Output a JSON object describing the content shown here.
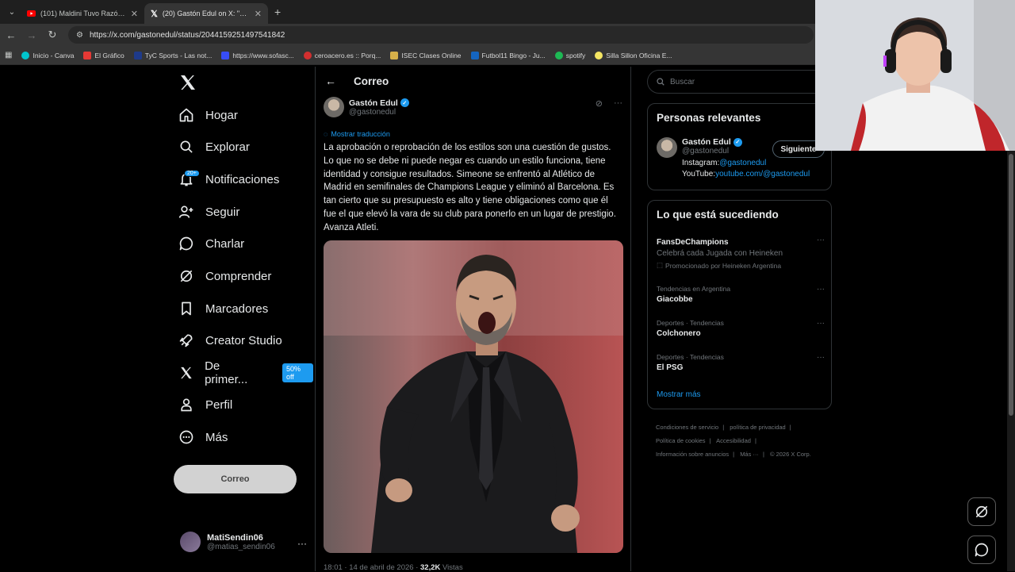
{
  "browser": {
    "tabs": [
      {
        "title": "(101) Maldini Tuvo Razón Sobr...",
        "icon": "youtube-icon",
        "color": "#ff0000",
        "active": false
      },
      {
        "title": "(20) Gastón Edul on X: \"La aprob...",
        "icon": "x-icon",
        "color": "#ffffff",
        "active": true
      }
    ],
    "url": "https://x.com/gastonedul/status/2044159251497541842",
    "bookmarks": [
      {
        "label": "Inicio - Canva",
        "color": "#00c4cc"
      },
      {
        "label": "El Gráfico",
        "color": "#e53935"
      },
      {
        "label": "TyC Sports - Las not...",
        "color": "#1e3a8a"
      },
      {
        "label": "https://www.sofasc...",
        "color": "#374df5"
      },
      {
        "label": "ceroacero.es :: Porq...",
        "color": "#d32f2f"
      },
      {
        "label": "ISEC Clases Online",
        "color": "#d6b04a"
      },
      {
        "label": "Futbol11 Bingo - Ju...",
        "color": "#1565c0"
      },
      {
        "label": "spotify",
        "color": "#1db954"
      },
      {
        "label": "Silla Sillon Oficina E...",
        "color": "#f5e663"
      }
    ]
  },
  "sidebar": {
    "items": [
      {
        "label": "Hogar",
        "icon": "home-icon"
      },
      {
        "label": "Explorar",
        "icon": "search-icon"
      },
      {
        "label": "Notificaciones",
        "icon": "bell-icon",
        "badge": "20+"
      },
      {
        "label": "Seguir",
        "icon": "follow-icon"
      },
      {
        "label": "Charlar",
        "icon": "chat-icon"
      },
      {
        "label": "Comprender",
        "icon": "grok-icon"
      },
      {
        "label": "Marcadores",
        "icon": "bookmark-icon"
      },
      {
        "label": "Creator Studio",
        "icon": "rocket-icon"
      },
      {
        "label": "De primer...",
        "icon": "x-premium-icon",
        "promo": "50% off"
      },
      {
        "label": "Perfil",
        "icon": "person-icon"
      },
      {
        "label": "Más",
        "icon": "more-circle-icon"
      }
    ],
    "post_button": "Correo",
    "user": {
      "name": "MatiSendin06",
      "handle": "@matias_sendin06"
    }
  },
  "main": {
    "header_title": "Correo",
    "tweet": {
      "author_name": "Gastón Edul",
      "author_handle": "@gastonedul",
      "translate_label": "Mostrar traducción",
      "text": "La aprobación o reprobación de los estilos son una cuestión de gustos. Lo que no se debe ni puede negar es cuando un estilo funciona, tiene identidad y consigue resultados. Simeone se enfrentó al Atlético de Madrid en semifinales de Champions League y eliminó al Barcelona. Es tan cierto que su presupuesto es alto y tiene obligaciones como que él fue el que elevó la vara de su club para ponerlo en un lugar de prestigio. Avanza Atleti.",
      "time": "18:01 · 14 de abril de 2026 · ",
      "views_count": "32,2K",
      "views_label": " Vistas"
    }
  },
  "right": {
    "search_placeholder": "Buscar",
    "relevant": {
      "title": "Personas relevantes",
      "name": "Gastón Edul",
      "handle": "@gastonedul",
      "bio_instagram_label": "Instagram:",
      "bio_instagram_link": "@gastonedul",
      "bio_youtube_label": "YouTube:",
      "bio_youtube_link": "youtube.com/@gastonedul",
      "follow_label": "Siguiente"
    },
    "happening": {
      "title": "Lo que está sucediendo",
      "promo": {
        "name": "FansDeChampions",
        "sub": "Celebrá cada Jugada con Heineken",
        "promoted": "Promocionado por Heineken Argentina"
      },
      "trends": [
        {
          "context": "Tendencias en Argentina",
          "name": "Giacobbe"
        },
        {
          "context": "Deportes · Tendencias",
          "name": "Colchonero"
        },
        {
          "context": "Deportes · Tendencias",
          "name": "El PSG"
        }
      ],
      "show_more": "Mostrar más"
    },
    "footer": {
      "line1": [
        "Condiciones de servicio",
        "|",
        "política de privacidad",
        "|"
      ],
      "line2": [
        "Política de cookies",
        "|",
        "Accesibilidad",
        "|"
      ],
      "line3": [
        "Información sobre anuncios",
        "|",
        "Más ···",
        "|",
        "© 2026 X Corp."
      ]
    }
  },
  "colors": {
    "accent": "#1d9bf0",
    "background": "#000000",
    "border": "#2f3336",
    "muted": "#71767b"
  }
}
